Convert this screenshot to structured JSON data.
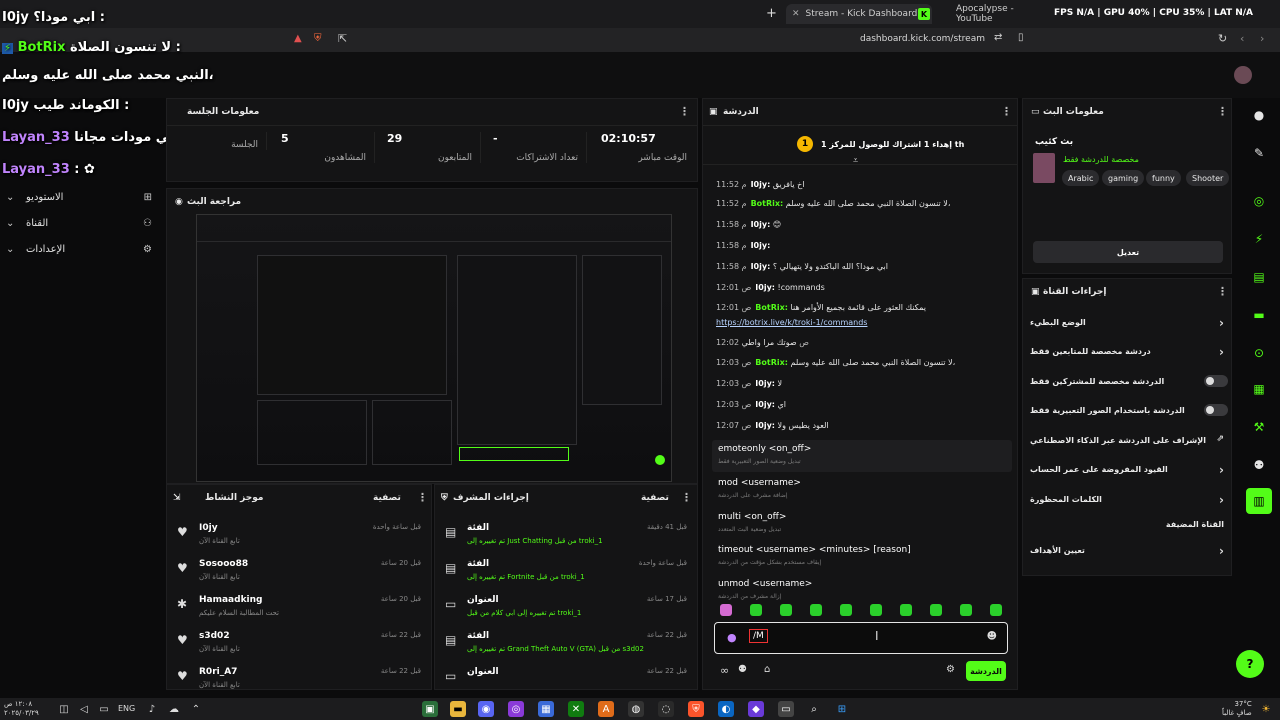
{
  "browser": {
    "tabs": [
      {
        "label": "Stream - Kick Dashboard"
      },
      {
        "label": "Apocalypse - YouTube"
      }
    ],
    "url": "dashboard.kick.com/stream",
    "perf": "FPS N/A | GPU 40% | CPU 35% | LAT N/A"
  },
  "overlay_chat": [
    {
      "user": "I0jy",
      "text": "ابي مودا؟ :"
    },
    {
      "user": "BotRix",
      "text": "لا تنسون الصلاة :"
    },
    {
      "user": "",
      "text": "النبي محمد صلى الله عليه وسلم،"
    },
    {
      "user": "I0jy",
      "text": "الكوماند طيب :"
    },
    {
      "user": "Layan_33",
      "text": "سمعت في مودات مجانا :"
    },
    {
      "user": "Layan_33",
      "text": ": ✿"
    }
  ],
  "leftnav": [
    {
      "label": "الاستوديو",
      "icon": "grid-icon"
    },
    {
      "label": "القناة",
      "icon": "users-icon"
    },
    {
      "label": "الإعدادات",
      "icon": "gear-icon"
    }
  ],
  "session": {
    "title": "معلومات الجلسة",
    "stats": [
      {
        "value": "02:10:57",
        "label": "الوقت مباشر"
      },
      {
        "value": "-",
        "label": "تعداد الاشتراكات"
      },
      {
        "value": "29",
        "label": "المتابعون"
      },
      {
        "value": "5",
        "label": "المشاهدون"
      },
      {
        "value": "",
        "label": "الجلسة"
      }
    ]
  },
  "preview": {
    "title": "مراجعة البث"
  },
  "activity": {
    "title": "موجز النشاط",
    "filter": "تصفية",
    "rows": [
      {
        "user": "I0jy",
        "sub": "تابع القناة الآن",
        "time": "قبل ساعة واحدة"
      },
      {
        "user": "Sosooo88",
        "sub": "تابع القناة الآن",
        "time": "قبل 20 ساعة"
      },
      {
        "user": "Hamaadking",
        "sub": "تحت المطالبة السلام عليكم",
        "time": "قبل 20 ساعة"
      },
      {
        "user": "s3d02",
        "sub": "تابع القناة الآن",
        "time": "قبل 22 ساعة"
      },
      {
        "user": "R0ri_A7",
        "sub": "تابع القناة الآن",
        "time": "قبل 22 ساعة"
      }
    ]
  },
  "modactions": {
    "title": "إجراءات المشرف",
    "filter": "تصفية",
    "rows": [
      {
        "title": "الفئة",
        "sub": "تم تغييره إلى Just Chatting من قبل troki_1",
        "time": "قبل 41 دقيقة"
      },
      {
        "title": "الفئة",
        "sub": "تم تغييره إلى Fortnite من قبل troki_1",
        "time": "قبل ساعة واحدة"
      },
      {
        "title": "العنوان",
        "sub": "تم تغييره إلى ابي كلام من قبل troki_1",
        "time": "قبل 17 ساعة"
      },
      {
        "title": "الفئة",
        "sub": "تم تغييره إلى Grand Theft Auto V (GTA) من قبل s3d02",
        "time": "قبل 22 ساعة"
      },
      {
        "title": "العنوان",
        "sub": "",
        "time": "قبل 22 ساعة"
      }
    ]
  },
  "chat": {
    "title": "الدردشة",
    "pinned": "إهداء 1 اشتراك للوصول للمركز 1 th",
    "messages": [
      {
        "time": "11:52 م",
        "user": "I0jy:",
        "text": "اخ يافريق"
      },
      {
        "time": "11:52 م",
        "user": "BotRix:",
        "bot": true,
        "text": "لا تنسون الصلاة النبي محمد صلى الله عليه وسلم،"
      },
      {
        "time": "11:58 م",
        "user": "I0jy:",
        "text": "😊"
      },
      {
        "time": "11:58 م",
        "user": "I0jy:",
        "text": ""
      },
      {
        "time": "11:58 م",
        "user": "I0jy:",
        "text": "ابي مودا؟ الله الباكتدو ولا يتهيالي ؟"
      },
      {
        "time": "12:01 ص",
        "user": "I0jy:",
        "text": "!commands"
      },
      {
        "time": "12:01 ص",
        "user": "BotRix:",
        "bot": true,
        "text": "يمكنك العثور على قائمة بجميع الأوامر هنا"
      },
      {
        "time": "",
        "user": "",
        "text": "https://botrix.live/k/troki-1/commands"
      },
      {
        "time": "12:02 ص",
        "user": "",
        "text": "صوتك مرا واطي"
      },
      {
        "time": "12:03 ص",
        "user": "BotRix:",
        "bot": true,
        "text": "لا تنسون الصلاة النبي محمد صلى الله عليه وسلم،"
      },
      {
        "time": "12:03 ص",
        "user": "I0jy:",
        "text": "لا"
      },
      {
        "time": "12:03 ص",
        "user": "I0jy:",
        "text": "اي"
      },
      {
        "time": "12:07 ص",
        "user": "I0jy:",
        "text": "العود يطيس ولا"
      }
    ],
    "commands": [
      {
        "cmd": "emoteonly <on_off>",
        "desc": "تبديل وضعية الصور التعبيرية فقط"
      },
      {
        "cmd": "mod <username>",
        "desc": "إضافة مشرف على الدردشة"
      },
      {
        "cmd": "multi <on_off>",
        "desc": "تبديل وضعية البث المتعدد"
      },
      {
        "cmd": "timeout <username> <minutes> [reason]",
        "desc": "إيقاف مستخدم بشكل مؤقت من الدردشة"
      },
      {
        "cmd": "unmod <username>",
        "desc": "إزالة مشرف من الدردشة"
      }
    ],
    "input_value": "/M",
    "send_label": "الدردشة"
  },
  "streaminfo": {
    "title": "معلومات البث",
    "stream_title": "بث كئيب",
    "subtitle": "مخصصة للدردشة فقط",
    "tags": [
      "Arabic",
      "gaming",
      "funny",
      "Shooter"
    ],
    "edit_label": "تعديل"
  },
  "channelactions": {
    "title": "إجراءات القناة",
    "rows": [
      {
        "label": "الوضع البطيء",
        "type": "chevron"
      },
      {
        "label": "دردشة مخصصة للمتابعين فقط",
        "type": "chevron"
      },
      {
        "label": "الدردشة مخصصة للمشتركين فقط",
        "type": "toggle"
      },
      {
        "label": "الدردشة باستخدام الصور التعبيرية فقط",
        "type": "toggle"
      },
      {
        "label": "الإشراف على الدردشة عبر الذكاء الاصطناعي",
        "type": "link"
      },
      {
        "label": "القيود المفروضة على عمر الحساب",
        "type": "chevron"
      },
      {
        "label": "الكلمات المحظورة",
        "type": "chevron"
      },
      {
        "label": "القناة المضيفة",
        "type": "none"
      },
      {
        "label": "تعيين الأهداف",
        "type": "chevron"
      }
    ]
  },
  "taskbar": {
    "clock_time": "١٢:٠٨ ص",
    "clock_date": "٢٠٢٥/٠٣/٢٩",
    "lang": "ENG",
    "weather_temp": "37°C",
    "weather_desc": "صافٍ غالباً"
  },
  "colors": {
    "accent": "#53fc18",
    "bg": "#0b0b0c",
    "panel": "#141415"
  }
}
